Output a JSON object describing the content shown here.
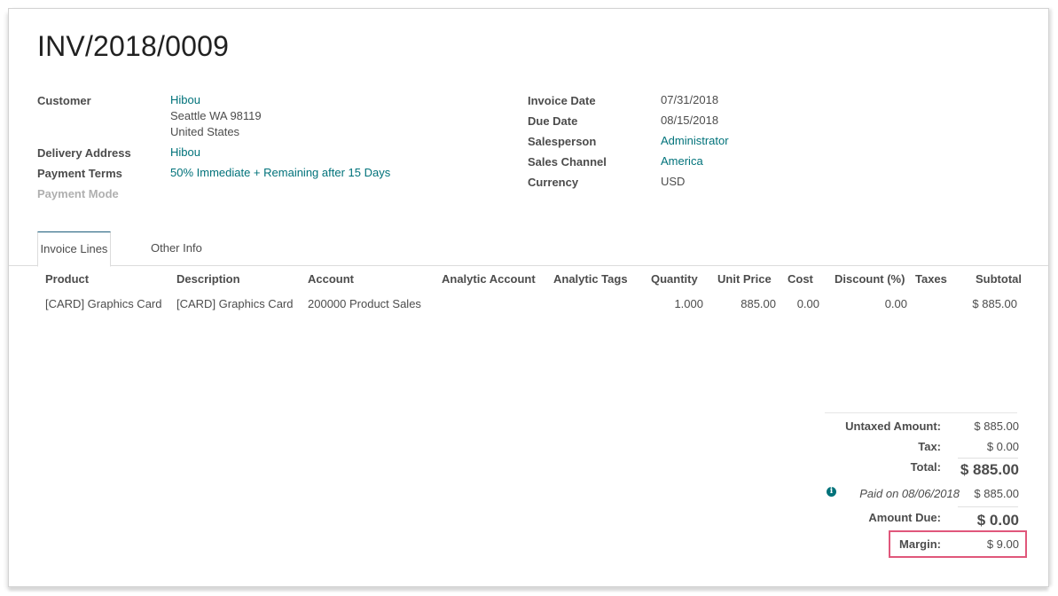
{
  "invoice": {
    "title": "INV/2018/0009"
  },
  "left_fields": {
    "customer_label": "Customer",
    "customer_name": "Hibou",
    "customer_address_line1": "Seattle WA 98119",
    "customer_address_line2": "United States",
    "delivery_address_label": "Delivery Address",
    "delivery_address_value": "Hibou",
    "payment_terms_label": "Payment Terms",
    "payment_terms_value": "50% Immediate + Remaining after 15 Days",
    "payment_mode_label": "Payment Mode"
  },
  "right_fields": {
    "invoice_date_label": "Invoice Date",
    "invoice_date_value": "07/31/2018",
    "due_date_label": "Due Date",
    "due_date_value": "08/15/2018",
    "salesperson_label": "Salesperson",
    "salesperson_value": "Administrator",
    "sales_channel_label": "Sales Channel",
    "sales_channel_value": "America",
    "currency_label": "Currency",
    "currency_value": "USD"
  },
  "tabs": [
    {
      "label": "Invoice Lines",
      "active": true
    },
    {
      "label": "Other Info",
      "active": false
    }
  ],
  "lines_table": {
    "columns": [
      "Product",
      "Description",
      "Account",
      "Analytic Account",
      "Analytic Tags",
      "Quantity",
      "Unit Price",
      "Cost",
      "Discount (%)",
      "Taxes",
      "Subtotal"
    ],
    "rows": [
      {
        "product": "[CARD] Graphics Card",
        "description": "[CARD] Graphics Card",
        "account": "200000 Product Sales",
        "analytic_account": "",
        "analytic_tags": "",
        "quantity": "1.000",
        "unit_price": "885.00",
        "cost": "0.00",
        "discount": "0.00",
        "taxes": "",
        "subtotal": "$ 885.00"
      }
    ]
  },
  "totals": {
    "untaxed_label": "Untaxed Amount:",
    "untaxed_value": "$ 885.00",
    "tax_label": "Tax:",
    "tax_value": "$ 0.00",
    "total_label": "Total:",
    "total_value": "$ 885.00",
    "payment_text": "Paid on 08/06/2018",
    "payment_value": "$ 885.00",
    "amount_due_label": "Amount Due:",
    "amount_due_value": "$ 0.00",
    "margin_label": "Margin:",
    "margin_value": "$ 9.00"
  },
  "colors": {
    "link": "#00727a",
    "highlight_border": "#e0577b",
    "active_tab_top": "#1a5c7a"
  }
}
